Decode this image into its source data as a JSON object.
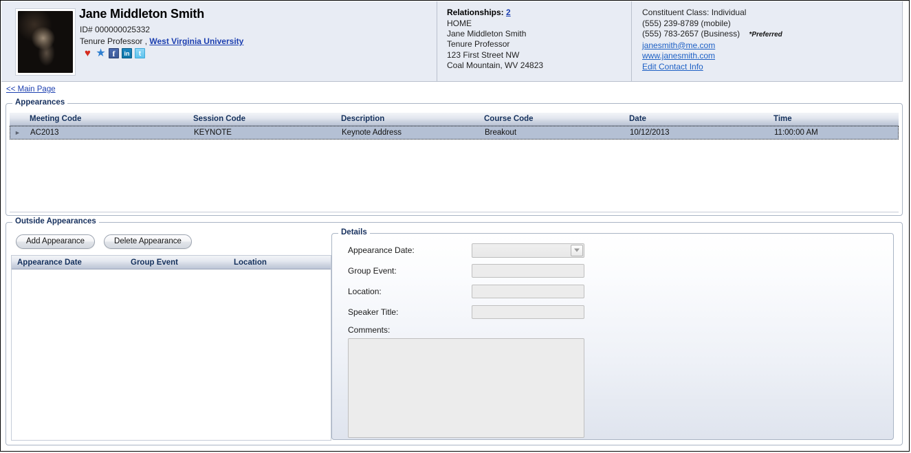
{
  "person": {
    "name": "Jane Middleton Smith",
    "id_label": "ID# 000000025332",
    "title": "Tenure Professor ,",
    "organization": "West Virginia University",
    "social_icons": [
      {
        "name": "heart-icon",
        "glyph": "♥"
      },
      {
        "name": "star-icon",
        "glyph": "★"
      },
      {
        "name": "facebook-icon",
        "glyph": "f"
      },
      {
        "name": "linkedin-icon",
        "glyph": "in"
      },
      {
        "name": "twitter-icon",
        "glyph": "t"
      }
    ]
  },
  "relationships": {
    "label": "Relationships:",
    "count": "2",
    "lines": [
      "HOME",
      "Jane Middleton Smith",
      "Tenure Professor",
      "123 First Street NW",
      "Coal Mountain, WV 24823"
    ]
  },
  "contact": {
    "constituent_class": "Constituent Class: Individual",
    "phone_mobile": "(555) 239-8789 (mobile)",
    "phone_business": "(555) 783-2657 (Business)",
    "preferred_tag": "*Preferred",
    "email": "janesmith@me.com",
    "website": "www.janesmith.com",
    "edit_link": "Edit Contact Info"
  },
  "nav": {
    "main_page_link": "<< Main Page"
  },
  "appearances_panel": {
    "legend": "Appearances",
    "columns": [
      "Meeting Code",
      "Session Code",
      "Description",
      "Course Code",
      "Date",
      "Time"
    ],
    "rows": [
      {
        "meeting_code": "AC2013",
        "session_code": "KEYNOTE",
        "description": "Keynote Address",
        "course_code": "Breakout",
        "date": "10/12/2013",
        "time": "11:00:00 AM",
        "selected": true
      }
    ]
  },
  "outside_panel": {
    "legend": "Outside Appearances",
    "add_button": "Add Appearance",
    "delete_button": "Delete Appearance",
    "columns": [
      "Appearance Date",
      "Group Event",
      "Location"
    ],
    "rows": []
  },
  "details_panel": {
    "legend": "Details",
    "fields": {
      "appearance_date_label": "Appearance Date:",
      "appearance_date_value": "",
      "group_event_label": "Group Event:",
      "group_event_value": "",
      "location_label": "Location:",
      "location_value": "",
      "speaker_title_label": "Speaker Title:",
      "speaker_title_value": "",
      "comments_label": "Comments:",
      "comments_value": ""
    }
  }
}
